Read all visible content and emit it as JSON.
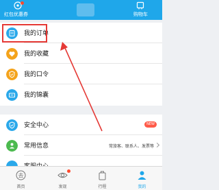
{
  "header": {
    "left_label": "红包优惠券",
    "right_label": "购物车"
  },
  "menu": [
    {
      "label": "我的订单",
      "icon": "order-icon",
      "color": "#2aa8ea"
    },
    {
      "label": "我的收藏",
      "icon": "heart-icon",
      "color": "#f4a31b"
    },
    {
      "label": "我的口令",
      "icon": "shield-icon",
      "color": "#f4a31b"
    },
    {
      "label": "我的锦囊",
      "icon": "ticket-icon",
      "color": "#2aa8ea"
    },
    {
      "label": "安全中心",
      "icon": "security-shield-icon",
      "color": "#2aa8ea",
      "badge": "NEW"
    },
    {
      "label": "常用信息",
      "icon": "user-info-icon",
      "color": "#4cba4f",
      "detail": "常旅客、联系人、发票等"
    },
    {
      "label": "客服中心",
      "icon": "service-icon",
      "color": "#2aa8ea"
    }
  ],
  "tabs": [
    {
      "label": "首页",
      "icon": "home-icon"
    },
    {
      "label": "发现",
      "icon": "eye-icon"
    },
    {
      "label": "行程",
      "icon": "luggage-icon"
    },
    {
      "label": "我的",
      "icon": "person-icon"
    }
  ],
  "colors": {
    "primary": "#1fa7ea",
    "highlight": "#e53935",
    "badge": "#ff5a48"
  }
}
